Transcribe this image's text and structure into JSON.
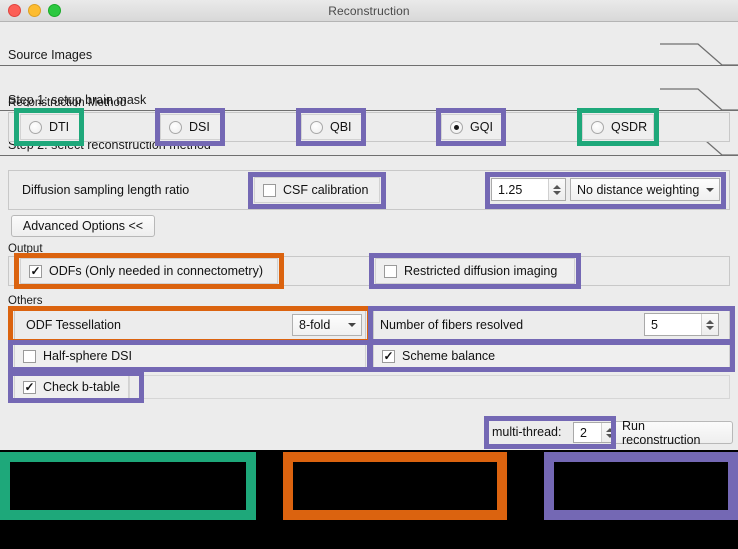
{
  "window": {
    "title": "Reconstruction",
    "traffic_lights": [
      "close-button",
      "minimize-button",
      "zoom-button"
    ]
  },
  "sections": [
    {
      "label": "Source Images"
    },
    {
      "label": "Step 1: setup brain mask"
    },
    {
      "label": "Step 2: select reconstruction method"
    }
  ],
  "recon_method": {
    "group_label": "Reconstruction Method",
    "options": [
      {
        "label": "DTI",
        "selected": false
      },
      {
        "label": "DSI",
        "selected": false
      },
      {
        "label": "QBI",
        "selected": false
      },
      {
        "label": "GQI",
        "selected": true
      },
      {
        "label": "QSDR",
        "selected": false
      }
    ]
  },
  "params": {
    "diffusion_label": "Diffusion sampling length ratio",
    "csf_label": "CSF calibration",
    "csf_checked": false,
    "ratio_value": "1.25",
    "weighting_value": "No distance weighting",
    "advanced_button": "Advanced Options <<"
  },
  "output": {
    "group_label": "Output",
    "odf_label": "ODFs (Only needed in connectometry)",
    "odf_checked": true,
    "rdi_label": "Restricted diffusion imaging",
    "rdi_checked": false
  },
  "others": {
    "group_label": "Others",
    "tessellation_label": "ODF Tessellation",
    "tessellation_value": "8-fold",
    "fibers_label": "Number of fibers resolved",
    "fibers_value": "5",
    "halfsphere_label": "Half-sphere DSI",
    "halfsphere_checked": false,
    "scheme_label": "Scheme balance",
    "scheme_checked": true,
    "btable_label": "Check b-table",
    "btable_checked": true
  },
  "footer": {
    "thread_label": "multi-thread:",
    "thread_value": "2",
    "run_button": "Run reconstruction"
  },
  "annotation_colors": {
    "green": "#1ea87a",
    "purple": "#7468b4",
    "orange": "#db630f"
  }
}
